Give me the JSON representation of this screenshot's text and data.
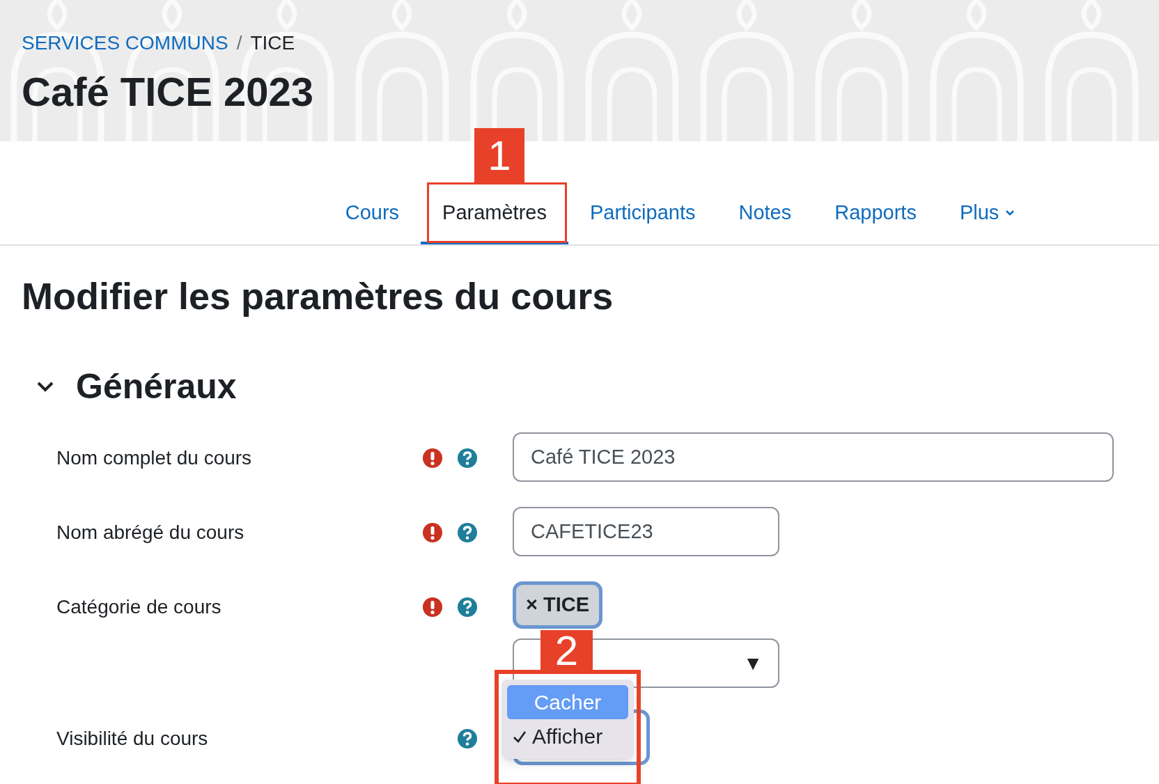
{
  "breadcrumb": [
    {
      "label": "SERVICES COMMUNS",
      "link": true
    },
    {
      "label": "TICE",
      "link": false
    }
  ],
  "breadcrumb_separator": "/",
  "course_title": "Café TICE 2023",
  "tabs": [
    {
      "label": "Cours",
      "selected": false
    },
    {
      "label": "Paramètres",
      "selected": true
    },
    {
      "label": "Participants",
      "selected": false
    },
    {
      "label": "Notes",
      "selected": false
    },
    {
      "label": "Rapports",
      "selected": false
    },
    {
      "label": "Plus",
      "selected": false,
      "menu": true
    }
  ],
  "page_heading": "Modifier les paramètres du cours",
  "section": {
    "title": "Généraux",
    "expanded": true
  },
  "fields": [
    {
      "kind": "text",
      "label": "Nom complet du cours",
      "required": true,
      "value": "Café TICE 2023",
      "wide": true
    },
    {
      "kind": "text",
      "label": "Nom abrégé du cours",
      "required": true,
      "value": "CAFETICE23",
      "wide": false
    },
    {
      "kind": "autocomplete",
      "label": "Catégorie de cours",
      "required": true,
      "chip": "TICE",
      "chip_remove": "×",
      "arrow": "▼"
    },
    {
      "kind": "select",
      "label": "Visibilité du cours",
      "required": false,
      "options": [
        {
          "label": "Cacher",
          "selected": true,
          "checked": false
        },
        {
          "label": "Afficher",
          "selected": false,
          "checked": true
        }
      ]
    }
  ],
  "annotations": [
    {
      "number": "1"
    },
    {
      "number": "2"
    }
  ]
}
